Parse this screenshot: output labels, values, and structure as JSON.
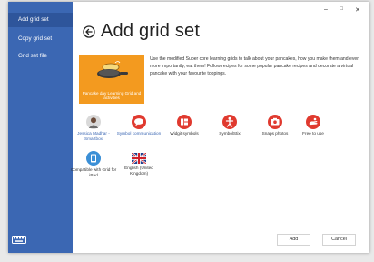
{
  "window": {
    "minimize_label": "–",
    "maximize_label": "□",
    "close_label": "✕"
  },
  "sidebar": {
    "items": [
      {
        "label": "Add grid set",
        "active": true
      },
      {
        "label": "Copy grid set",
        "active": false
      },
      {
        "label": "Grid set file",
        "active": false
      }
    ],
    "keyboard_icon": "keyboard-icon"
  },
  "header": {
    "title": "Add grid set",
    "back_icon": "back-arrow-icon"
  },
  "card": {
    "caption": "Pancake day Learning Grid and activities",
    "background": "#f39a1f",
    "image_icon": "pancake-pan-icon"
  },
  "description": "Use the modified Super core learning grids to talk about your pancakes, how you make them and even more importantly, eat them! Follow recipes for some popular pancake recipes and decorate a virtual pancake with your favourite toppings.",
  "tags": [
    {
      "label": "Jessica Madhar - Smartbox",
      "icon": "person-avatar-icon",
      "is_link": true
    },
    {
      "label": "Symbol communication",
      "icon": "speech-bubble-icon",
      "is_link": true
    },
    {
      "label": "Widgit symbols",
      "icon": "widgit-icon",
      "is_link": false
    },
    {
      "label": "SymbolStix",
      "icon": "symbolstix-figure-icon",
      "is_link": false
    },
    {
      "label": "Snaps photos",
      "icon": "camera-icon",
      "is_link": false
    },
    {
      "label": "Free to use",
      "icon": "hand-icon",
      "is_link": false
    },
    {
      "label": "Compatible with Grid for iPad",
      "icon": "ipad-icon",
      "is_link": false
    },
    {
      "label": "English (United Kingdom)",
      "icon": "uk-flag-icon",
      "is_link": false
    }
  ],
  "footer": {
    "add_label": "Add",
    "cancel_label": "Cancel"
  },
  "colors": {
    "sidebar": "#3b67b3",
    "sidebar_active": "#2e559b",
    "accent_red": "#e03a2f",
    "card_orange": "#f39a1f",
    "link_blue": "#3b67b3"
  }
}
